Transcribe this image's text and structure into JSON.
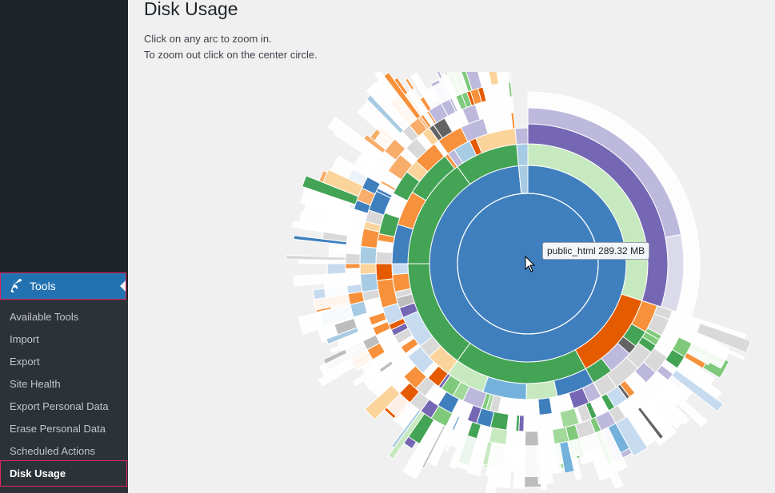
{
  "sidebar": {
    "menu": {
      "label": "Tools",
      "icon": "wrench-icon",
      "accent": "#2271b1"
    },
    "submenu": [
      {
        "label": "Available Tools"
      },
      {
        "label": "Import"
      },
      {
        "label": "Export"
      },
      {
        "label": "Site Health"
      },
      {
        "label": "Export Personal Data"
      },
      {
        "label": "Erase Personal Data"
      },
      {
        "label": "Scheduled Actions"
      },
      {
        "label": "Disk Usage",
        "current": true
      }
    ]
  },
  "main": {
    "title": "Disk Usage",
    "instructions": [
      "Click on any arc to zoom in.",
      "To zoom out click on the center circle."
    ]
  },
  "tooltip": {
    "text": "public_html 289.32 MB"
  },
  "chart_data": {
    "type": "sunburst",
    "title": "Disk Usage",
    "root": {
      "name": "public_html",
      "size": "289.32 MB",
      "color": "#3f7fbe"
    },
    "rings": [
      {
        "level": 1,
        "arcs": [
          {
            "from": 0.0,
            "to": 0.985,
            "color": "#3f7fbe"
          },
          {
            "from": 0.985,
            "to": 1.0,
            "color": "#a6cbe3"
          }
        ]
      },
      {
        "level": 2,
        "arcs": [
          {
            "from": 0.0,
            "to": 0.3,
            "color": "#c7e9c0"
          },
          {
            "from": 0.3,
            "to": 0.42,
            "color": "#e55b00"
          },
          {
            "from": 0.42,
            "to": 0.6,
            "color": "#44a455"
          },
          {
            "from": 0.6,
            "to": 0.75,
            "color": "#44a455"
          },
          {
            "from": 0.75,
            "to": 0.9,
            "color": "#44a455"
          },
          {
            "from": 0.9,
            "to": 0.985,
            "color": "#44a455"
          },
          {
            "from": 0.985,
            "to": 1.0,
            "color": "#a6cbe3"
          }
        ]
      }
    ],
    "palette": [
      "#3f7fbe",
      "#a6cbe3",
      "#44a455",
      "#c7e9c0",
      "#e55b00",
      "#f7913b",
      "#fbd49b",
      "#7567b3",
      "#bcb9dc",
      "#636363",
      "#bdbdbd",
      "#d9d9d9",
      "#74b2dc",
      "#7ec97a",
      "#dadaeb"
    ]
  }
}
